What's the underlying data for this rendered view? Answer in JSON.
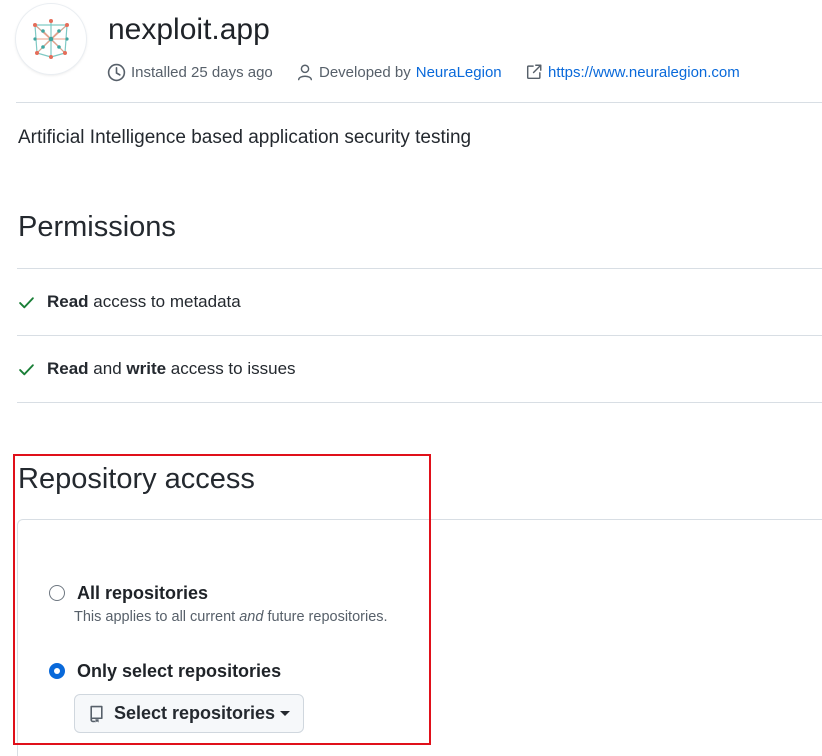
{
  "app": {
    "name": "nexploit.app",
    "installed": "Installed 25 days ago",
    "developed_prefix": "Developed by",
    "developer": "NeuraLegion",
    "website": "https://www.neuralegion.com",
    "description": "Artificial Intelligence based application security testing"
  },
  "icons": {
    "logo": "neural-network-logo",
    "installed": "clock-icon",
    "developer": "person-icon",
    "website": "external-link-icon",
    "permission": "check-icon",
    "select_button": "repo-icon"
  },
  "permissions": {
    "title": "Permissions",
    "items": [
      {
        "parts": [
          {
            "text": "Read",
            "bold": true
          },
          {
            "text": " access to metadata",
            "bold": false
          }
        ]
      },
      {
        "parts": [
          {
            "text": "Read",
            "bold": true
          },
          {
            "text": " and ",
            "bold": false
          },
          {
            "text": "write",
            "bold": true
          },
          {
            "text": " access to issues",
            "bold": false
          }
        ]
      }
    ]
  },
  "repository_access": {
    "title": "Repository access",
    "options": [
      {
        "label": "All repositories",
        "selected": false,
        "description_parts": [
          {
            "text": "This applies to all current ",
            "italic": false
          },
          {
            "text": "and",
            "italic": true
          },
          {
            "text": " future repositories.",
            "italic": false
          }
        ]
      },
      {
        "label": "Only select repositories",
        "selected": true
      }
    ],
    "select_button": "Select repositories"
  },
  "colors": {
    "link": "#0969da",
    "check": "#1a7f37",
    "radio_selected": "#0969da",
    "highlight_border": "#e0101a"
  }
}
